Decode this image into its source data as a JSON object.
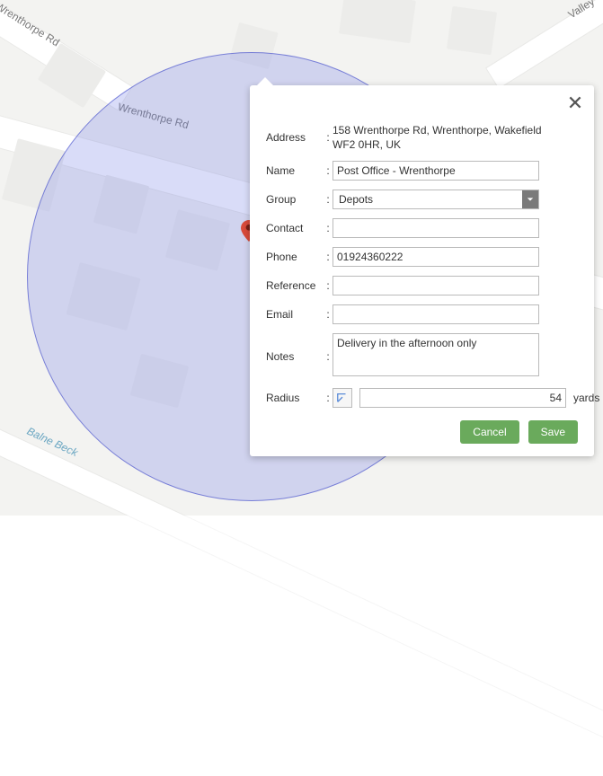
{
  "map": {
    "roads": {
      "wrenthorpe_top": "Wrenthorpe Rd",
      "wrenthorpe_main": "Wrenthorpe Rd",
      "balne_beck": "Balne Beck",
      "valley": "Valley"
    },
    "radius_circle_color": "#7d87e5",
    "marker_color": "#d84a3a"
  },
  "popup": {
    "labels": {
      "address": "Address",
      "name": "Name",
      "group": "Group",
      "contact": "Contact",
      "phone": "Phone",
      "reference": "Reference",
      "email": "Email",
      "notes": "Notes",
      "radius": "Radius"
    },
    "values": {
      "address": "158 Wrenthorpe Rd, Wrenthorpe, Wakefield WF2 0HR, UK",
      "name": "Post Office - Wrenthorpe",
      "group": "Depots",
      "contact": "",
      "phone": "01924360222",
      "reference": "",
      "email": "",
      "notes": "Delivery in the afternoon only",
      "radius": "54",
      "radius_unit": "yards"
    },
    "buttons": {
      "cancel": "Cancel",
      "save": "Save"
    }
  }
}
